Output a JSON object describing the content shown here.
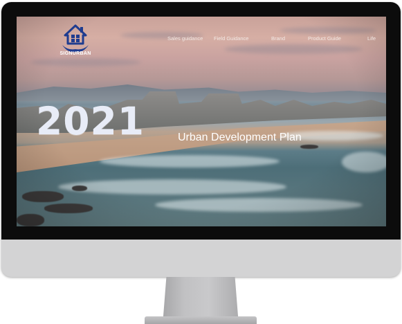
{
  "site": {
    "logo_text": "SIGNURBAN",
    "nav": [
      "Sales guidance",
      "Field Guidance",
      "Brand",
      "Product Guide",
      "Life"
    ]
  },
  "hero": {
    "year": "2021",
    "subtitle": "Urban Development Plan"
  },
  "colors": {
    "logo_blue": "#1f3c8f",
    "headline": "#e8ecf7",
    "bezel": "#0c0c0c",
    "frame": "#d3d3d4"
  },
  "icons": {
    "logo": "house-on-hands-icon"
  }
}
